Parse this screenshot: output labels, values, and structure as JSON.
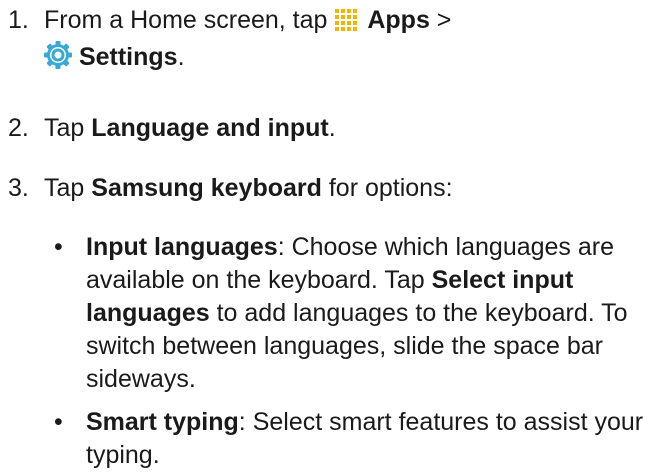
{
  "steps": [
    {
      "number": "1.",
      "prefix": "From a Home screen, tap ",
      "apps_label": "Apps",
      "separator": " >",
      "settings_label": "Settings",
      "suffix": "."
    },
    {
      "number": "2.",
      "prefix": "Tap ",
      "bold": "Language and input",
      "suffix": "."
    },
    {
      "number": "3.",
      "prefix": "Tap ",
      "bold": "Samsung keyboard",
      "suffix": " for options:"
    }
  ],
  "bullets": [
    {
      "symbol": "•",
      "title": "Input languages",
      "text1": ": Choose which languages are available on the keyboard. Tap ",
      "bold2": "Select input languages",
      "text2": " to add languages to the keyboard. To switch between languages, slide the space bar sideways."
    },
    {
      "symbol": "•",
      "title": "Smart typing",
      "text1": ": Select smart features to assist your typing."
    }
  ],
  "icons": {
    "apps": "apps-grid-icon",
    "settings": "settings-gear-icon"
  },
  "colors": {
    "apps_icon": "#f2b600",
    "settings_icon": "#38a9d6"
  }
}
